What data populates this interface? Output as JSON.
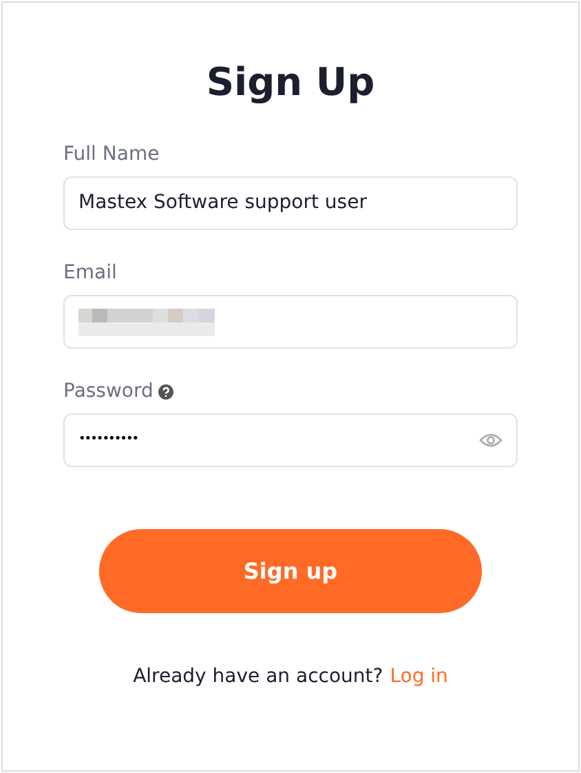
{
  "title": "Sign Up",
  "fields": [
    {
      "kind": "text",
      "label": "Full Name",
      "value": "Mastex Software support user"
    },
    {
      "kind": "redacted",
      "label": "Email"
    },
    {
      "kind": "password",
      "label": "Password",
      "value": "••••••••••"
    }
  ],
  "submit": "Sign up",
  "footer": {
    "text": "Already have an account?",
    "link": "Log in"
  }
}
